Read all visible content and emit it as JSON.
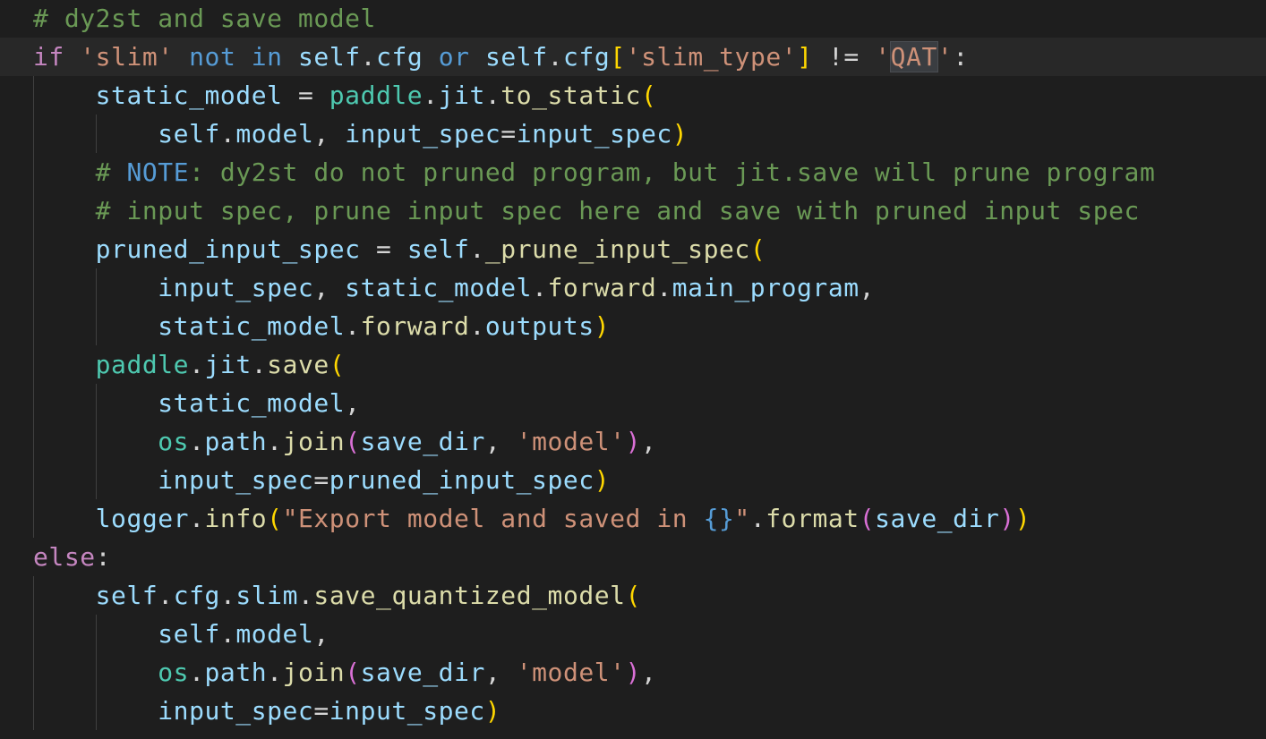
{
  "editor": {
    "theme": {
      "background": "#1e1e1e",
      "current_line_background": "#282828",
      "indent_guide": "#404040",
      "word_highlight": "#3a3d41"
    },
    "current_line_index": 1,
    "lines": [
      [
        {
          "t": "# dy2st and save model",
          "c": "#6a9955"
        }
      ],
      [
        {
          "t": "if",
          "c": "#c586c0"
        },
        {
          "t": " ",
          "c": "#d4d4d4"
        },
        {
          "t": "'slim'",
          "c": "#ce9178"
        },
        {
          "t": " ",
          "c": "#d4d4d4"
        },
        {
          "t": "not in",
          "c": "#569cd6"
        },
        {
          "t": " ",
          "c": "#d4d4d4"
        },
        {
          "t": "self",
          "c": "#9cdcfe"
        },
        {
          "t": ".",
          "c": "#d4d4d4"
        },
        {
          "t": "cfg",
          "c": "#9cdcfe"
        },
        {
          "t": " ",
          "c": "#d4d4d4"
        },
        {
          "t": "or",
          "c": "#569cd6"
        },
        {
          "t": " ",
          "c": "#d4d4d4"
        },
        {
          "t": "self",
          "c": "#9cdcfe"
        },
        {
          "t": ".",
          "c": "#d4d4d4"
        },
        {
          "t": "cfg",
          "c": "#9cdcfe"
        },
        {
          "t": "[",
          "c": "#ffd700"
        },
        {
          "t": "'slim_type'",
          "c": "#ce9178"
        },
        {
          "t": "]",
          "c": "#ffd700"
        },
        {
          "t": " != ",
          "c": "#d4d4d4"
        },
        {
          "t": "'",
          "c": "#ce9178"
        },
        {
          "t": "QAT",
          "c": "#ce9178",
          "hl": true
        },
        {
          "t": "'",
          "c": "#ce9178"
        },
        {
          "t": ":",
          "c": "#d4d4d4"
        }
      ],
      [
        {
          "t": "    ",
          "c": "#d4d4d4"
        },
        {
          "t": "static_model",
          "c": "#9cdcfe"
        },
        {
          "t": " = ",
          "c": "#d4d4d4"
        },
        {
          "t": "paddle",
          "c": "#4ec9b0"
        },
        {
          "t": ".",
          "c": "#d4d4d4"
        },
        {
          "t": "jit",
          "c": "#9cdcfe"
        },
        {
          "t": ".",
          "c": "#d4d4d4"
        },
        {
          "t": "to_static",
          "c": "#dcdcaa"
        },
        {
          "t": "(",
          "c": "#ffd700"
        }
      ],
      [
        {
          "t": "        ",
          "c": "#d4d4d4"
        },
        {
          "t": "self",
          "c": "#9cdcfe"
        },
        {
          "t": ".",
          "c": "#d4d4d4"
        },
        {
          "t": "model",
          "c": "#9cdcfe"
        },
        {
          "t": ", ",
          "c": "#d4d4d4"
        },
        {
          "t": "input_spec",
          "c": "#9cdcfe"
        },
        {
          "t": "=",
          "c": "#d4d4d4"
        },
        {
          "t": "input_spec",
          "c": "#9cdcfe"
        },
        {
          "t": ")",
          "c": "#ffd700"
        }
      ],
      [
        {
          "t": "    ",
          "c": "#d4d4d4"
        },
        {
          "t": "# ",
          "c": "#6a9955"
        },
        {
          "t": "NOTE",
          "c": "#569cd6"
        },
        {
          "t": ": dy2st do not pruned program, but jit.save will prune program",
          "c": "#6a9955"
        }
      ],
      [
        {
          "t": "    ",
          "c": "#d4d4d4"
        },
        {
          "t": "# input spec, prune input spec here and save with pruned input spec",
          "c": "#6a9955"
        }
      ],
      [
        {
          "t": "    ",
          "c": "#d4d4d4"
        },
        {
          "t": "pruned_input_spec",
          "c": "#9cdcfe"
        },
        {
          "t": " = ",
          "c": "#d4d4d4"
        },
        {
          "t": "self",
          "c": "#9cdcfe"
        },
        {
          "t": ".",
          "c": "#d4d4d4"
        },
        {
          "t": "_prune_input_spec",
          "c": "#dcdcaa"
        },
        {
          "t": "(",
          "c": "#ffd700"
        }
      ],
      [
        {
          "t": "        ",
          "c": "#d4d4d4"
        },
        {
          "t": "input_spec",
          "c": "#9cdcfe"
        },
        {
          "t": ", ",
          "c": "#d4d4d4"
        },
        {
          "t": "static_model",
          "c": "#9cdcfe"
        },
        {
          "t": ".",
          "c": "#d4d4d4"
        },
        {
          "t": "forward",
          "c": "#dcdcaa"
        },
        {
          "t": ".",
          "c": "#d4d4d4"
        },
        {
          "t": "main_program",
          "c": "#9cdcfe"
        },
        {
          "t": ",",
          "c": "#d4d4d4"
        }
      ],
      [
        {
          "t": "        ",
          "c": "#d4d4d4"
        },
        {
          "t": "static_model",
          "c": "#9cdcfe"
        },
        {
          "t": ".",
          "c": "#d4d4d4"
        },
        {
          "t": "forward",
          "c": "#dcdcaa"
        },
        {
          "t": ".",
          "c": "#d4d4d4"
        },
        {
          "t": "outputs",
          "c": "#9cdcfe"
        },
        {
          "t": ")",
          "c": "#ffd700"
        }
      ],
      [
        {
          "t": "    ",
          "c": "#d4d4d4"
        },
        {
          "t": "paddle",
          "c": "#4ec9b0"
        },
        {
          "t": ".",
          "c": "#d4d4d4"
        },
        {
          "t": "jit",
          "c": "#9cdcfe"
        },
        {
          "t": ".",
          "c": "#d4d4d4"
        },
        {
          "t": "save",
          "c": "#dcdcaa"
        },
        {
          "t": "(",
          "c": "#ffd700"
        }
      ],
      [
        {
          "t": "        ",
          "c": "#d4d4d4"
        },
        {
          "t": "static_model",
          "c": "#9cdcfe"
        },
        {
          "t": ",",
          "c": "#d4d4d4"
        }
      ],
      [
        {
          "t": "        ",
          "c": "#d4d4d4"
        },
        {
          "t": "os",
          "c": "#4ec9b0"
        },
        {
          "t": ".",
          "c": "#d4d4d4"
        },
        {
          "t": "path",
          "c": "#9cdcfe"
        },
        {
          "t": ".",
          "c": "#d4d4d4"
        },
        {
          "t": "join",
          "c": "#dcdcaa"
        },
        {
          "t": "(",
          "c": "#da70d6"
        },
        {
          "t": "save_dir",
          "c": "#9cdcfe"
        },
        {
          "t": ", ",
          "c": "#d4d4d4"
        },
        {
          "t": "'model'",
          "c": "#ce9178"
        },
        {
          "t": ")",
          "c": "#da70d6"
        },
        {
          "t": ",",
          "c": "#d4d4d4"
        }
      ],
      [
        {
          "t": "        ",
          "c": "#d4d4d4"
        },
        {
          "t": "input_spec",
          "c": "#9cdcfe"
        },
        {
          "t": "=",
          "c": "#d4d4d4"
        },
        {
          "t": "pruned_input_spec",
          "c": "#9cdcfe"
        },
        {
          "t": ")",
          "c": "#ffd700"
        }
      ],
      [
        {
          "t": "    ",
          "c": "#d4d4d4"
        },
        {
          "t": "logger",
          "c": "#9cdcfe"
        },
        {
          "t": ".",
          "c": "#d4d4d4"
        },
        {
          "t": "info",
          "c": "#dcdcaa"
        },
        {
          "t": "(",
          "c": "#ffd700"
        },
        {
          "t": "\"Export model and saved in ",
          "c": "#ce9178"
        },
        {
          "t": "{}",
          "c": "#569cd6"
        },
        {
          "t": "\"",
          "c": "#ce9178"
        },
        {
          "t": ".",
          "c": "#d4d4d4"
        },
        {
          "t": "format",
          "c": "#dcdcaa"
        },
        {
          "t": "(",
          "c": "#da70d6"
        },
        {
          "t": "save_dir",
          "c": "#9cdcfe"
        },
        {
          "t": ")",
          "c": "#da70d6"
        },
        {
          "t": ")",
          "c": "#ffd700"
        }
      ],
      [
        {
          "t": "else",
          "c": "#c586c0"
        },
        {
          "t": ":",
          "c": "#d4d4d4"
        }
      ],
      [
        {
          "t": "    ",
          "c": "#d4d4d4"
        },
        {
          "t": "self",
          "c": "#9cdcfe"
        },
        {
          "t": ".",
          "c": "#d4d4d4"
        },
        {
          "t": "cfg",
          "c": "#9cdcfe"
        },
        {
          "t": ".",
          "c": "#d4d4d4"
        },
        {
          "t": "slim",
          "c": "#9cdcfe"
        },
        {
          "t": ".",
          "c": "#d4d4d4"
        },
        {
          "t": "save_quantized_model",
          "c": "#dcdcaa"
        },
        {
          "t": "(",
          "c": "#ffd700"
        }
      ],
      [
        {
          "t": "        ",
          "c": "#d4d4d4"
        },
        {
          "t": "self",
          "c": "#9cdcfe"
        },
        {
          "t": ".",
          "c": "#d4d4d4"
        },
        {
          "t": "model",
          "c": "#9cdcfe"
        },
        {
          "t": ",",
          "c": "#d4d4d4"
        }
      ],
      [
        {
          "t": "        ",
          "c": "#d4d4d4"
        },
        {
          "t": "os",
          "c": "#4ec9b0"
        },
        {
          "t": ".",
          "c": "#d4d4d4"
        },
        {
          "t": "path",
          "c": "#9cdcfe"
        },
        {
          "t": ".",
          "c": "#d4d4d4"
        },
        {
          "t": "join",
          "c": "#dcdcaa"
        },
        {
          "t": "(",
          "c": "#da70d6"
        },
        {
          "t": "save_dir",
          "c": "#9cdcfe"
        },
        {
          "t": ", ",
          "c": "#d4d4d4"
        },
        {
          "t": "'model'",
          "c": "#ce9178"
        },
        {
          "t": ")",
          "c": "#da70d6"
        },
        {
          "t": ",",
          "c": "#d4d4d4"
        }
      ],
      [
        {
          "t": "        ",
          "c": "#d4d4d4"
        },
        {
          "t": "input_spec",
          "c": "#9cdcfe"
        },
        {
          "t": "=",
          "c": "#d4d4d4"
        },
        {
          "t": "input_spec",
          "c": "#9cdcfe"
        },
        {
          "t": ")",
          "c": "#ffd700"
        }
      ]
    ]
  }
}
